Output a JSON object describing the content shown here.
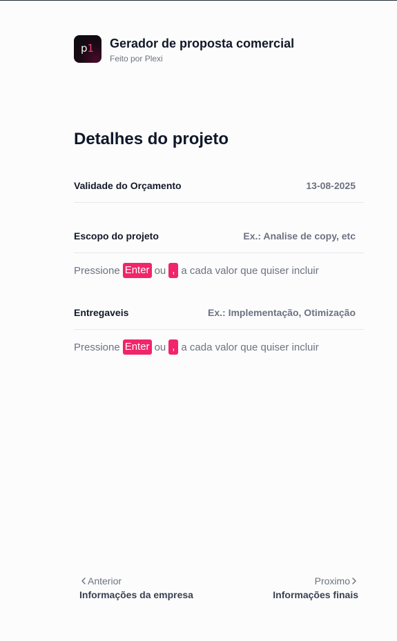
{
  "header": {
    "logo_text": "p",
    "logo_accent": "1",
    "title": "Gerador de proposta comercial",
    "subtitle": "Feito por Plexi"
  },
  "section": {
    "title": "Detalhes do projeto"
  },
  "fields": {
    "validade": {
      "label": "Validade do Orçamento",
      "value": "13-08-2025"
    },
    "escopo": {
      "label": "Escopo do projeto",
      "placeholder": "Ex.: Analise de copy, etc",
      "hint_before": "Pressione",
      "key_enter": "Enter",
      "hint_or": "ou",
      "key_comma": ",",
      "hint_after": "a cada valor que quiser incluir"
    },
    "entregaveis": {
      "label": "Entregaveis",
      "placeholder": "Ex.: Implementação, Otimização",
      "hint_before": "Pressione",
      "key_enter": "Enter",
      "hint_or": "ou",
      "key_comma": ",",
      "hint_after": "a cada valor que quiser incluir"
    }
  },
  "navigation": {
    "prev": {
      "small": "Anterior",
      "big": "Informações da empresa",
      "icon": "chevron-left-icon"
    },
    "next": {
      "small": "Proximo",
      "big": "Informações finais",
      "icon": "chevron-right-icon"
    }
  },
  "colors": {
    "accent": "#f0256a",
    "text_muted": "#6b7280",
    "background": "#fcfcfc"
  }
}
